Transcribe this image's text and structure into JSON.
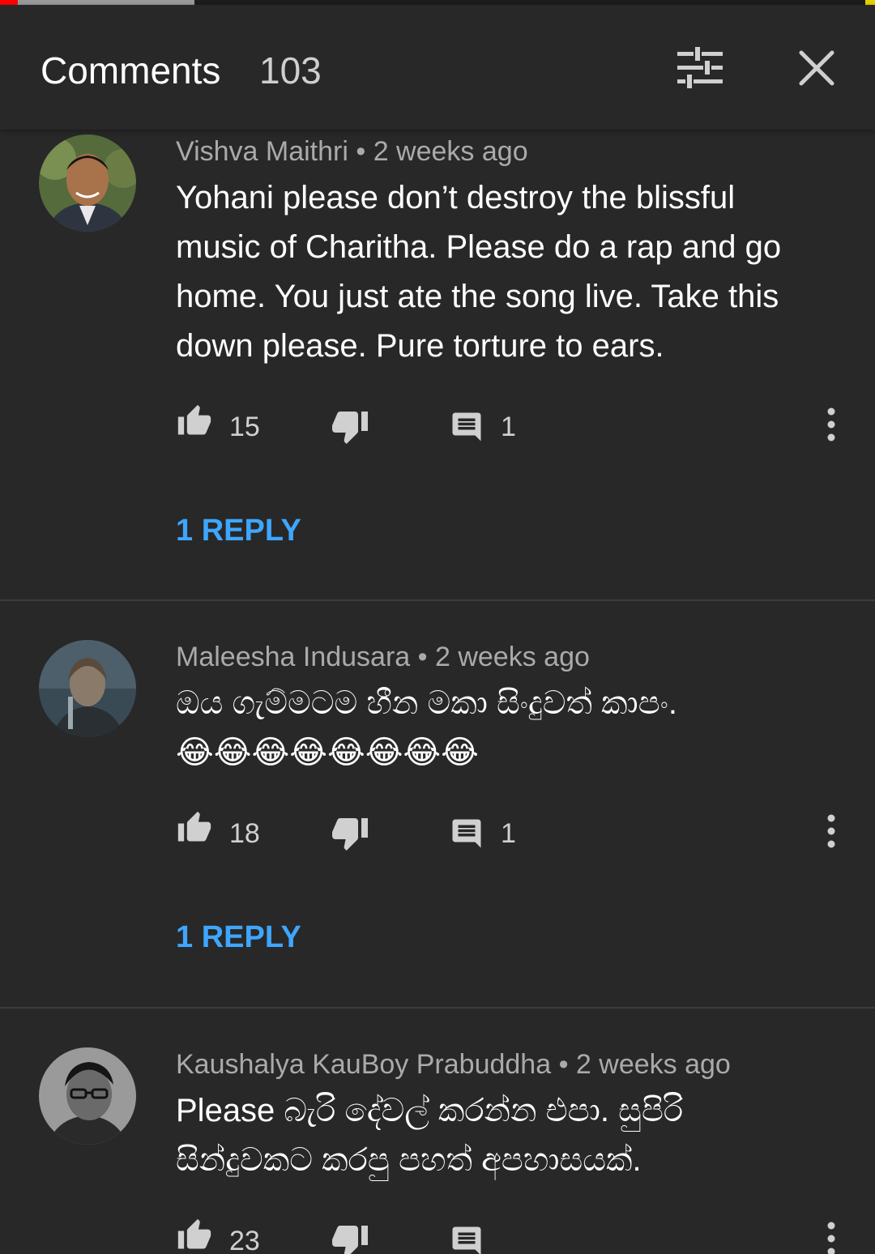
{
  "colors": {
    "background": "#282828",
    "accent_link": "#3ea6ff",
    "progress_played": "#ff0000"
  },
  "header": {
    "title": "Comments",
    "count": "103"
  },
  "comments": [
    {
      "author": "Vishva Maithri",
      "time": "2 weeks ago",
      "text": "Yohani please don’t destroy the blissful music of Charitha. Please do a rap and go home. You just ate the song live. Take this down please. Pure torture to ears.",
      "likes": "15",
      "replies": "1",
      "reply_link": "1 REPLY"
    },
    {
      "author": "Maleesha Indusara",
      "time": "2 weeks ago",
      "text": "ඔය ගැම්මටම හීන මකා සිංදුවත් කාපං.",
      "emoji": "😂😂😂😂😂😂😂😂",
      "likes": "18",
      "replies": "1",
      "reply_link": "1 REPLY"
    },
    {
      "author": "Kaushalya KauBoy Prabuddha",
      "time": "2 weeks ago",
      "text": "Please බැරි දේවල් කරන්න එපා. සුපිරි සින්දුවකට කරපු පහත් අපහාසයක්.",
      "likes": "23"
    }
  ],
  "separator": " • "
}
